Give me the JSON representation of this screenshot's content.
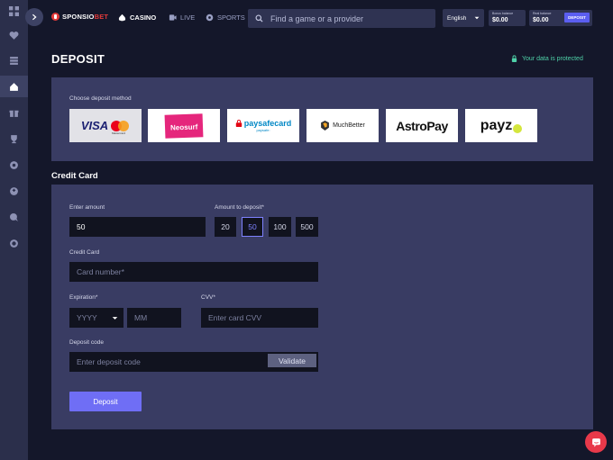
{
  "sidebar": {
    "icons": [
      "grid-icon",
      "heart-icon",
      "casino-chips-icon",
      "lobby-icon",
      "gift-icon",
      "trophy-icon",
      "settings-icon",
      "support-icon",
      "chat-bubble-icon",
      "help-icon"
    ]
  },
  "topbar": {
    "logo_prefix": "SPONSIO",
    "logo_accent": "BET",
    "nav": {
      "casino": "CASINO",
      "live": "LIVE",
      "sports": "SPORTS"
    },
    "search_placeholder": "Find a game or a provider",
    "language": "English",
    "bonus_balance_label": "Bonus balance",
    "bonus_balance_value": "$0.00",
    "real_balance_label": "Real balance",
    "real_balance_value": "$0.00",
    "deposit_label": "DEPOSIT"
  },
  "page": {
    "title": "DEPOSIT",
    "protected_text": "Your data is protected",
    "methods_label": "Choose deposit method",
    "methods": [
      {
        "name": "visa-mastercard",
        "label": "VISA",
        "sub": "Mastercard"
      },
      {
        "name": "neosurf",
        "label": "Neosurf"
      },
      {
        "name": "paysafecard",
        "label": "paysafecard",
        "sub": "paysafe:"
      },
      {
        "name": "muchbetter",
        "label": "MuchBetter"
      },
      {
        "name": "astropay",
        "label": "AstroPay"
      },
      {
        "name": "payz",
        "label": "payz"
      }
    ],
    "section_title": "Credit Card"
  },
  "form": {
    "enter_amount_label": "Enter amount",
    "amount_value": "50",
    "amount_to_deposit_label": "Amount to deposit*",
    "amounts": [
      "20",
      "50",
      "100",
      "500"
    ],
    "selected_amount": "50",
    "credit_card_label": "Credit Card",
    "card_number_placeholder": "Card number*",
    "expiration_label": "Expiration*",
    "year_placeholder": "YYYY",
    "month_placeholder": "MM",
    "cvv_label": "CVV*",
    "cvv_placeholder": "Enter card CVV",
    "deposit_code_label": "Deposit code",
    "deposit_code_placeholder": "Enter deposit code",
    "validate_label": "Validate",
    "submit_label": "Deposit"
  },
  "colors": {
    "background": "#14172a",
    "sidebar": "#2b2f4b",
    "panel": "#393c63",
    "accent": "#6f6ef5",
    "secure": "#4fd1a8",
    "brand_red": "#e23a3a"
  }
}
